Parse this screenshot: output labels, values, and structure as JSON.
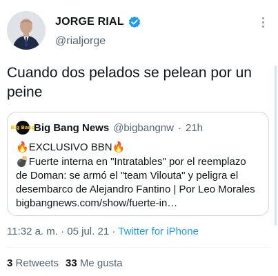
{
  "author": {
    "name": "JORGE RIAL",
    "handle": "@rialjorge",
    "verified": true
  },
  "tweet_text": "Cuando dos pelados se pelean por un peine",
  "quoted_tweet": {
    "avatar_text": "Big Bang",
    "name": "Big Bang News",
    "handle": "@bigbangnw",
    "separator": "·",
    "time": "21h",
    "lines": [
      {
        "emoji": "🔥",
        "text": "EXCLUSIVO BBN",
        "emoji_after": "🔥"
      },
      {
        "emoji": "💣",
        "text": "Fuerte interna en \"Intratables\" por el reemplazo"
      },
      {
        "text": "de Doman: se armó el \"team Vilouta\" y peligra el"
      },
      {
        "text": "desembarco de Alejandro Fantino | Por Leo Morales"
      },
      {
        "text": "bigbangnews.com/show/fuerte-in…"
      }
    ]
  },
  "meta": {
    "time": "11:32 a. m.",
    "dot1": " · ",
    "date": "05 jul. 21",
    "dot2": " · ",
    "source": "Twitter for iPhone"
  },
  "stats": {
    "retweets_count": "3",
    "retweets_label": "Retweets",
    "likes_count": "33",
    "likes_label": "Me gusta"
  },
  "colors": {
    "accent": "#1d9bf0",
    "secondary_text": "#536471",
    "border": "#cfd9de"
  }
}
